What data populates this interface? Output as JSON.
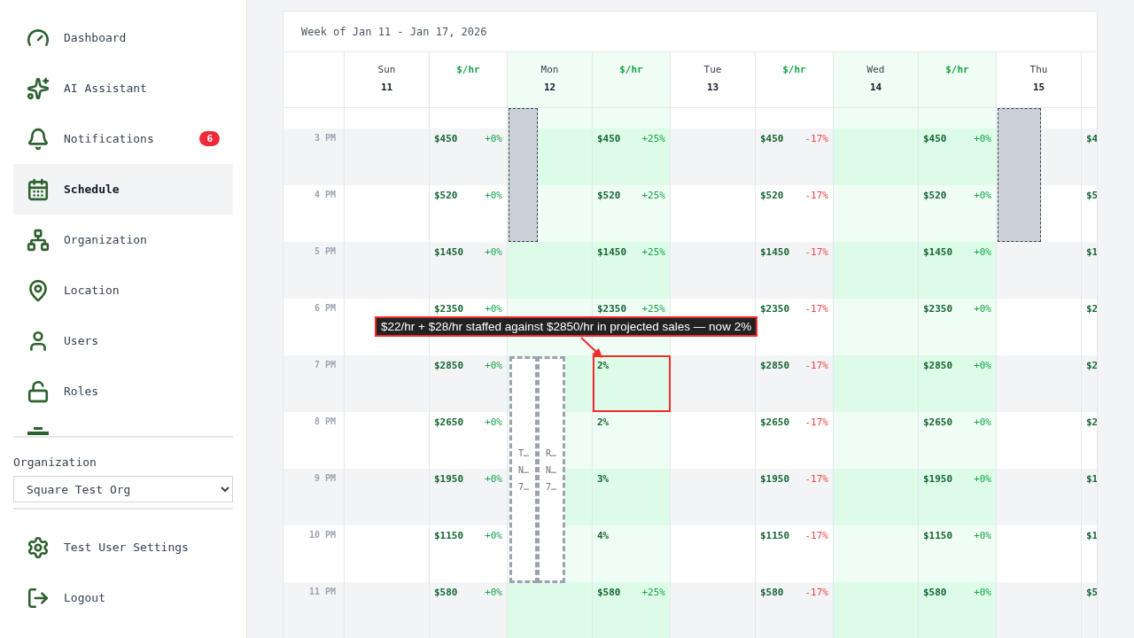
{
  "sidebar": {
    "items": [
      {
        "kind": "dashboard",
        "label": "Dashboard",
        "selected": false
      },
      {
        "kind": "assistant",
        "label": "AI Assistant",
        "selected": false
      },
      {
        "kind": "notifications",
        "label": "Notifications",
        "selected": false,
        "badge": "6"
      },
      {
        "kind": "schedule",
        "label": "Schedule",
        "selected": true
      },
      {
        "kind": "organization",
        "label": "Organization",
        "selected": false
      },
      {
        "kind": "location",
        "label": "Location",
        "selected": false
      },
      {
        "kind": "users",
        "label": "Users",
        "selected": false
      },
      {
        "kind": "roles",
        "label": "Roles",
        "selected": false
      }
    ],
    "org_label": "Organization",
    "org_select": "Square Test Org",
    "footer": [
      {
        "kind": "settings",
        "label": "Test User Settings"
      },
      {
        "kind": "logout",
        "label": "Logout"
      }
    ]
  },
  "schedule": {
    "title": "Week of Jan 11 - Jan 17, 2026",
    "days": [
      {
        "day": "Sun",
        "date": "11",
        "rate_header": "$/hr",
        "highlighted": false
      },
      {
        "day": "Mon",
        "date": "12",
        "rate_header": "$/hr",
        "highlighted": true,
        "shifts": [
          {
            "kind": "filled"
          },
          {
            "kind": "open",
            "lines": [
              "T…",
              "N…",
              "7…"
            ]
          },
          {
            "kind": "open",
            "lines": [
              "R…",
              "N…",
              "7…"
            ]
          }
        ]
      },
      {
        "day": "Tue",
        "date": "13",
        "rate_header": "$/hr",
        "highlighted": false
      },
      {
        "day": "Wed",
        "date": "14",
        "rate_header": "$/hr",
        "highlighted": true
      },
      {
        "day": "Thu",
        "date": "15",
        "highlighted": false,
        "shifts": [
          {
            "kind": "filled"
          }
        ]
      }
    ],
    "rows": [
      {
        "time": "3 PM",
        "sales": [
          {
            "kind": "sales",
            "amount": "$450",
            "change": "+0%",
            "negative": false
          },
          {
            "kind": "sales",
            "amount": "$450",
            "change": "+25%",
            "negative": false
          },
          {
            "kind": "sales",
            "amount": "$450",
            "change": "-17%",
            "negative": true
          },
          {
            "kind": "sales",
            "amount": "$450",
            "change": "+0%",
            "negative": false
          },
          {
            "kind": "sales",
            "amount": "$4"
          }
        ]
      },
      {
        "time": "4 PM",
        "sales": [
          {
            "kind": "sales",
            "amount": "$520",
            "change": "+0%",
            "negative": false
          },
          {
            "kind": "sales",
            "amount": "$520",
            "change": "+25%",
            "negative": false
          },
          {
            "kind": "sales",
            "amount": "$520",
            "change": "-17%",
            "negative": true
          },
          {
            "kind": "sales",
            "amount": "$520",
            "change": "+0%",
            "negative": false
          },
          {
            "kind": "sales",
            "amount": "$5"
          }
        ]
      },
      {
        "time": "5 PM",
        "sales": [
          {
            "kind": "sales",
            "amount": "$1450",
            "change": "+0%",
            "negative": false
          },
          {
            "kind": "sales",
            "amount": "$1450",
            "change": "+25%",
            "negative": false
          },
          {
            "kind": "sales",
            "amount": "$1450",
            "change": "-17%",
            "negative": true
          },
          {
            "kind": "sales",
            "amount": "$1450",
            "change": "+0%",
            "negative": false
          },
          {
            "kind": "sales",
            "amount": "$1"
          }
        ]
      },
      {
        "time": "6 PM",
        "sales": [
          {
            "kind": "sales",
            "amount": "$2350",
            "change": "+0%",
            "negative": false
          },
          {
            "kind": "sales",
            "amount": "$2350",
            "change": "+25%",
            "negative": false
          },
          {
            "kind": "sales",
            "amount": "$2350",
            "change": "-17%",
            "negative": true
          },
          {
            "kind": "sales",
            "amount": "$2350",
            "change": "+0%",
            "negative": false
          },
          {
            "kind": "sales",
            "amount": "$2"
          }
        ]
      },
      {
        "time": "7 PM",
        "sales": [
          {
            "kind": "sales",
            "amount": "$2850",
            "change": "+0%",
            "negative": false
          },
          {
            "kind": "ratio",
            "amount": "2%",
            "highlighted": true
          },
          {
            "kind": "sales",
            "amount": "$2850",
            "change": "-17%",
            "negative": true
          },
          {
            "kind": "sales",
            "amount": "$2850",
            "change": "+0%",
            "negative": false
          },
          {
            "kind": "sales",
            "amount": "$2"
          }
        ]
      },
      {
        "time": "8 PM",
        "sales": [
          {
            "kind": "sales",
            "amount": "$2650",
            "change": "+0%",
            "negative": false
          },
          {
            "kind": "ratio",
            "amount": "2%",
            "highlighted": false
          },
          {
            "kind": "sales",
            "amount": "$2650",
            "change": "-17%",
            "negative": true
          },
          {
            "kind": "sales",
            "amount": "$2650",
            "change": "+0%",
            "negative": false
          },
          {
            "kind": "sales",
            "amount": "$2"
          }
        ]
      },
      {
        "time": "9 PM",
        "sales": [
          {
            "kind": "sales",
            "amount": "$1950",
            "change": "+0%",
            "negative": false
          },
          {
            "kind": "ratio",
            "amount": "3%",
            "highlighted": false
          },
          {
            "kind": "sales",
            "amount": "$1950",
            "change": "-17%",
            "negative": true
          },
          {
            "kind": "sales",
            "amount": "$1950",
            "change": "+0%",
            "negative": false
          },
          {
            "kind": "sales",
            "amount": "$1"
          }
        ]
      },
      {
        "time": "10 PM",
        "sales": [
          {
            "kind": "sales",
            "amount": "$1150",
            "change": "+0%",
            "negative": false
          },
          {
            "kind": "ratio",
            "amount": "4%",
            "highlighted": false
          },
          {
            "kind": "sales",
            "amount": "$1150",
            "change": "-17%",
            "negative": true
          },
          {
            "kind": "sales",
            "amount": "$1150",
            "change": "+0%",
            "negative": false
          },
          {
            "kind": "sales",
            "amount": "$1"
          }
        ]
      },
      {
        "time": "11 PM",
        "sales": [
          {
            "kind": "sales",
            "amount": "$580",
            "change": "+0%",
            "negative": false
          },
          {
            "kind": "sales",
            "amount": "$580",
            "change": "+25%",
            "negative": false
          },
          {
            "kind": "sales",
            "amount": "$580",
            "change": "-17%",
            "negative": true
          },
          {
            "kind": "sales",
            "amount": "$580",
            "change": "+0%",
            "negative": false
          },
          {
            "kind": "sales",
            "amount": "$5"
          }
        ]
      }
    ],
    "callout": "$22/hr + $28/hr staffed against $2850/hr in projected sales — now 2%"
  }
}
